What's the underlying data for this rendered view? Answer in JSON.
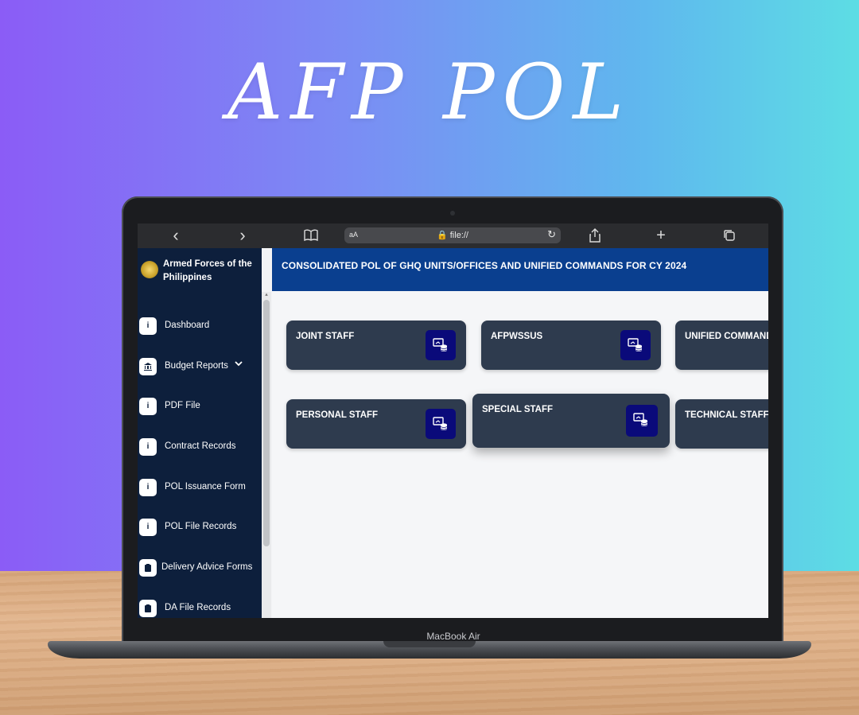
{
  "hero": {
    "title": "AFP POL"
  },
  "device": {
    "model_label": "MacBook Air"
  },
  "browser": {
    "back_icon": "‹",
    "forward_icon": "›",
    "text_size_label": "aA",
    "url": "🔒 file://",
    "reload_icon": "↻",
    "new_tab_icon": "+"
  },
  "sidebar": {
    "brand": "Armed Forces of the Philippines",
    "items": [
      {
        "label": "Dashboard",
        "icon": "info-icon"
      },
      {
        "label": "Budget Reports",
        "icon": "bank-icon",
        "has_dropdown": true
      },
      {
        "label": "PDF File",
        "icon": "info-icon"
      },
      {
        "label": "Contract Records",
        "icon": "info-icon"
      },
      {
        "label": "POL Issuance Form",
        "icon": "info-icon"
      },
      {
        "label": "POL File Records",
        "icon": "info-icon"
      },
      {
        "label": "Delivery Advice Forms",
        "icon": "clipboard-icon"
      },
      {
        "label": "DA File Records",
        "icon": "clipboard-icon"
      }
    ]
  },
  "main": {
    "title": "CONSOLIDATED POL OF GHQ UNITS/OFFICES AND UNIFIED COMMANDS FOR CY 2024",
    "cards": [
      {
        "label": "JOINT STAFF"
      },
      {
        "label": "AFPWSSUS"
      },
      {
        "label": "UNIFIED COMMANDS"
      },
      {
        "label": "PERSONAL STAFF"
      },
      {
        "label": "SPECIAL STAFF"
      },
      {
        "label": "TECHNICAL STAFF"
      }
    ]
  },
  "colors": {
    "sidebar_bg": "#0d1f3c",
    "header_bg": "#0a3f8f",
    "card_bg": "#2e3b4e",
    "card_button_bg": "#0a0a7a"
  }
}
